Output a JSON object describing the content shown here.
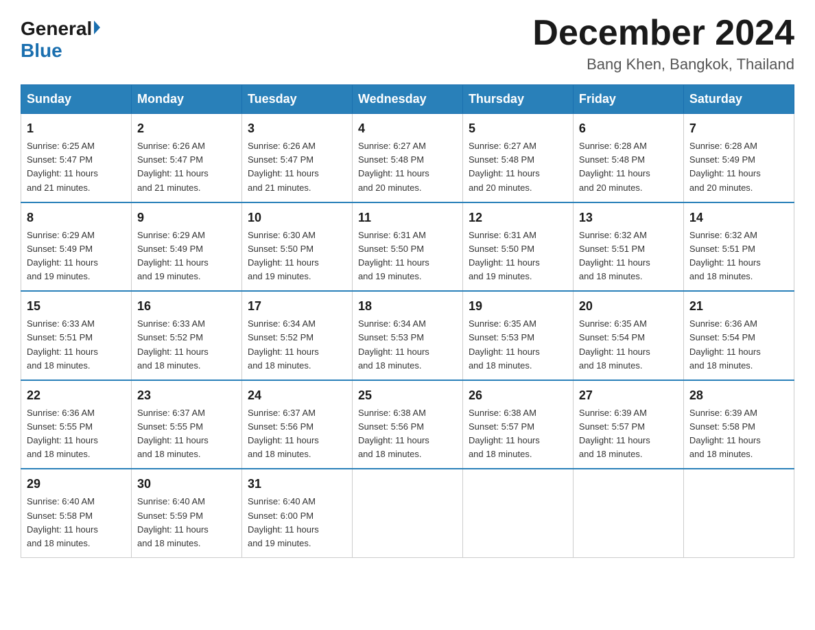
{
  "logo": {
    "general": "General",
    "blue": "Blue"
  },
  "title": {
    "month_year": "December 2024",
    "location": "Bang Khen, Bangkok, Thailand"
  },
  "weekdays": [
    "Sunday",
    "Monday",
    "Tuesday",
    "Wednesday",
    "Thursday",
    "Friday",
    "Saturday"
  ],
  "weeks": [
    [
      {
        "day": "1",
        "sunrise": "6:25 AM",
        "sunset": "5:47 PM",
        "daylight": "11 hours and 21 minutes."
      },
      {
        "day": "2",
        "sunrise": "6:26 AM",
        "sunset": "5:47 PM",
        "daylight": "11 hours and 21 minutes."
      },
      {
        "day": "3",
        "sunrise": "6:26 AM",
        "sunset": "5:47 PM",
        "daylight": "11 hours and 21 minutes."
      },
      {
        "day": "4",
        "sunrise": "6:27 AM",
        "sunset": "5:48 PM",
        "daylight": "11 hours and 20 minutes."
      },
      {
        "day": "5",
        "sunrise": "6:27 AM",
        "sunset": "5:48 PM",
        "daylight": "11 hours and 20 minutes."
      },
      {
        "day": "6",
        "sunrise": "6:28 AM",
        "sunset": "5:48 PM",
        "daylight": "11 hours and 20 minutes."
      },
      {
        "day": "7",
        "sunrise": "6:28 AM",
        "sunset": "5:49 PM",
        "daylight": "11 hours and 20 minutes."
      }
    ],
    [
      {
        "day": "8",
        "sunrise": "6:29 AM",
        "sunset": "5:49 PM",
        "daylight": "11 hours and 19 minutes."
      },
      {
        "day": "9",
        "sunrise": "6:29 AM",
        "sunset": "5:49 PM",
        "daylight": "11 hours and 19 minutes."
      },
      {
        "day": "10",
        "sunrise": "6:30 AM",
        "sunset": "5:50 PM",
        "daylight": "11 hours and 19 minutes."
      },
      {
        "day": "11",
        "sunrise": "6:31 AM",
        "sunset": "5:50 PM",
        "daylight": "11 hours and 19 minutes."
      },
      {
        "day": "12",
        "sunrise": "6:31 AM",
        "sunset": "5:50 PM",
        "daylight": "11 hours and 19 minutes."
      },
      {
        "day": "13",
        "sunrise": "6:32 AM",
        "sunset": "5:51 PM",
        "daylight": "11 hours and 18 minutes."
      },
      {
        "day": "14",
        "sunrise": "6:32 AM",
        "sunset": "5:51 PM",
        "daylight": "11 hours and 18 minutes."
      }
    ],
    [
      {
        "day": "15",
        "sunrise": "6:33 AM",
        "sunset": "5:51 PM",
        "daylight": "11 hours and 18 minutes."
      },
      {
        "day": "16",
        "sunrise": "6:33 AM",
        "sunset": "5:52 PM",
        "daylight": "11 hours and 18 minutes."
      },
      {
        "day": "17",
        "sunrise": "6:34 AM",
        "sunset": "5:52 PM",
        "daylight": "11 hours and 18 minutes."
      },
      {
        "day": "18",
        "sunrise": "6:34 AM",
        "sunset": "5:53 PM",
        "daylight": "11 hours and 18 minutes."
      },
      {
        "day": "19",
        "sunrise": "6:35 AM",
        "sunset": "5:53 PM",
        "daylight": "11 hours and 18 minutes."
      },
      {
        "day": "20",
        "sunrise": "6:35 AM",
        "sunset": "5:54 PM",
        "daylight": "11 hours and 18 minutes."
      },
      {
        "day": "21",
        "sunrise": "6:36 AM",
        "sunset": "5:54 PM",
        "daylight": "11 hours and 18 minutes."
      }
    ],
    [
      {
        "day": "22",
        "sunrise": "6:36 AM",
        "sunset": "5:55 PM",
        "daylight": "11 hours and 18 minutes."
      },
      {
        "day": "23",
        "sunrise": "6:37 AM",
        "sunset": "5:55 PM",
        "daylight": "11 hours and 18 minutes."
      },
      {
        "day": "24",
        "sunrise": "6:37 AM",
        "sunset": "5:56 PM",
        "daylight": "11 hours and 18 minutes."
      },
      {
        "day": "25",
        "sunrise": "6:38 AM",
        "sunset": "5:56 PM",
        "daylight": "11 hours and 18 minutes."
      },
      {
        "day": "26",
        "sunrise": "6:38 AM",
        "sunset": "5:57 PM",
        "daylight": "11 hours and 18 minutes."
      },
      {
        "day": "27",
        "sunrise": "6:39 AM",
        "sunset": "5:57 PM",
        "daylight": "11 hours and 18 minutes."
      },
      {
        "day": "28",
        "sunrise": "6:39 AM",
        "sunset": "5:58 PM",
        "daylight": "11 hours and 18 minutes."
      }
    ],
    [
      {
        "day": "29",
        "sunrise": "6:40 AM",
        "sunset": "5:58 PM",
        "daylight": "11 hours and 18 minutes."
      },
      {
        "day": "30",
        "sunrise": "6:40 AM",
        "sunset": "5:59 PM",
        "daylight": "11 hours and 18 minutes."
      },
      {
        "day": "31",
        "sunrise": "6:40 AM",
        "sunset": "6:00 PM",
        "daylight": "11 hours and 19 minutes."
      },
      null,
      null,
      null,
      null
    ]
  ]
}
